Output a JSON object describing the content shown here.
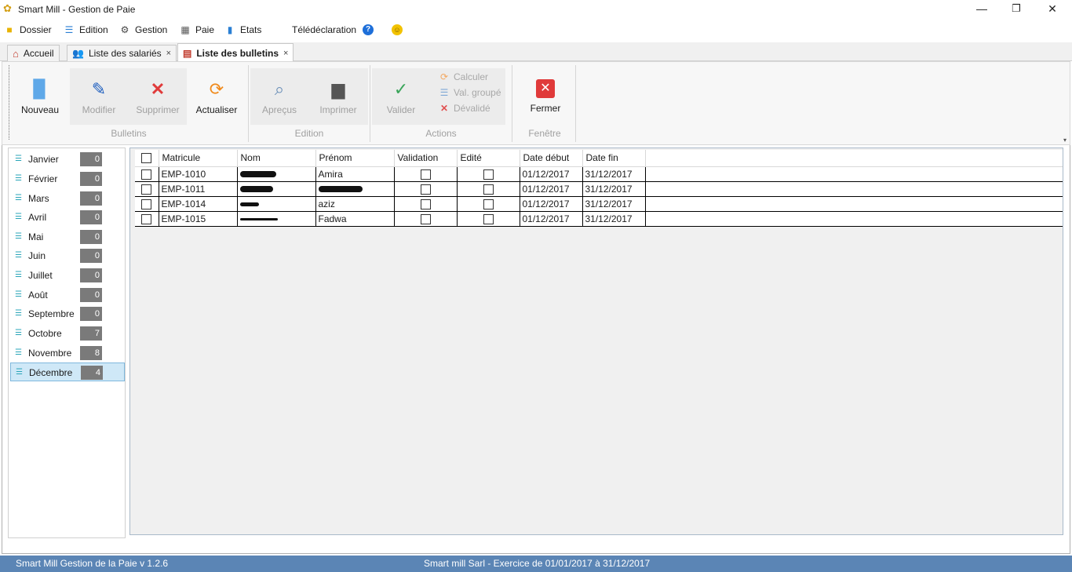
{
  "window": {
    "title": "Smart Mill - Gestion de Paie",
    "app_icon": "gear-flower-icon",
    "controls": [
      "minimize-icon",
      "restore-icon",
      "close-icon"
    ],
    "minimize_glyph": "—",
    "restore_glyph": "❐",
    "close_glyph": "✕"
  },
  "menu": {
    "items": [
      {
        "label": "Dossier",
        "icon": "folder-icon",
        "color": "#e8b300"
      },
      {
        "label": "Edition",
        "icon": "list-icon",
        "color": "#2a7fd4"
      },
      {
        "label": "Gestion",
        "icon": "gears-icon",
        "color": "#444444"
      },
      {
        "label": "Paie",
        "icon": "calculator-icon",
        "color": "#555555"
      },
      {
        "label": "Etats",
        "icon": "chart-icon",
        "color": "#2a7fd4"
      },
      {
        "label": "Télédéclaration",
        "icon": "help-icon",
        "color": "#1e6fd9"
      },
      {
        "label": "",
        "icon": "help-icon",
        "color": "#1e6fd9"
      },
      {
        "label": "",
        "icon": "smiley-icon",
        "color": "#f2c200"
      }
    ]
  },
  "tabs": [
    {
      "label": "Accueil",
      "icon": "home-icon",
      "closable": false,
      "active": false
    },
    {
      "label": "Liste des salariés",
      "icon": "users-icon",
      "closable": true,
      "active": false
    },
    {
      "label": "Liste des bulletins",
      "icon": "payslip-icon",
      "closable": true,
      "active": true
    }
  ],
  "tab_close_glyph": "×",
  "ribbon": {
    "groups": [
      {
        "label": "Bulletins"
      },
      {
        "label": "Edition"
      },
      {
        "label": "Actions"
      },
      {
        "label": "Fenêtre"
      }
    ],
    "buttons": {
      "nouveau": {
        "label": "Nouveau",
        "icon": "new-document-icon",
        "enabled": true
      },
      "modifier": {
        "label": "Modifier",
        "icon": "pencil-icon",
        "enabled": false
      },
      "supprimer": {
        "label": "Supprimer",
        "icon": "delete-x-icon",
        "enabled": false
      },
      "actualiser": {
        "label": "Actualiser",
        "icon": "refresh-icon",
        "enabled": true
      },
      "apercus": {
        "label": "Apreçus",
        "icon": "preview-icon",
        "enabled": false
      },
      "imprimer": {
        "label": "Imprimer",
        "icon": "printer-icon",
        "enabled": false
      },
      "valider": {
        "label": "Valider",
        "icon": "checkmark-icon",
        "enabled": false
      },
      "calculer": {
        "label": "Calculer",
        "icon": "refresh-icon",
        "enabled": false
      },
      "val_groupe": {
        "label": "Val. groupé",
        "icon": "list-icon",
        "enabled": false
      },
      "devalide": {
        "label": "Dévalidé",
        "icon": "delete-x-icon",
        "enabled": false
      },
      "fermer": {
        "label": "Fermer",
        "icon": "close-box-icon",
        "enabled": true
      }
    }
  },
  "months": [
    {
      "label": "Janvier",
      "count": "0"
    },
    {
      "label": "Février",
      "count": "0"
    },
    {
      "label": "Mars",
      "count": "0"
    },
    {
      "label": "Avril",
      "count": "0"
    },
    {
      "label": "Mai",
      "count": "0"
    },
    {
      "label": "Juin",
      "count": "0"
    },
    {
      "label": "Juillet",
      "count": "0"
    },
    {
      "label": "Août",
      "count": "0"
    },
    {
      "label": "Septembre",
      "count": "0"
    },
    {
      "label": "Octobre",
      "count": "7"
    },
    {
      "label": "Novembre",
      "count": "8"
    },
    {
      "label": "Décembre",
      "count": "4",
      "selected": true
    }
  ],
  "grid": {
    "columns": [
      "",
      "Matricule",
      "Nom",
      "Prénom",
      "Validation",
      "Edité",
      "Date début",
      "Date fin"
    ],
    "rows": [
      {
        "matricule": "EMP-1010",
        "nom_redacted": true,
        "prenom": "Amira",
        "prenom_redacted": false,
        "validation": false,
        "edite": false,
        "date_debut": "01/12/2017",
        "date_fin": "31/12/2017"
      },
      {
        "matricule": "EMP-1011",
        "nom_redacted": true,
        "prenom": "",
        "prenom_redacted": true,
        "validation": false,
        "edite": false,
        "date_debut": "01/12/2017",
        "date_fin": "31/12/2017"
      },
      {
        "matricule": "EMP-1014",
        "nom_redacted": true,
        "prenom": "aziz",
        "prenom_redacted": false,
        "validation": false,
        "edite": false,
        "date_debut": "01/12/2017",
        "date_fin": "31/12/2017"
      },
      {
        "matricule": "EMP-1015",
        "nom_redacted": true,
        "prenom": "Fadwa",
        "prenom_redacted": false,
        "validation": false,
        "edite": false,
        "date_debut": "01/12/2017",
        "date_fin": "31/12/2017"
      }
    ]
  },
  "status": {
    "left": "Smart Mill Gestion de la Paie v 1.2.6",
    "center": "Smart mill Sarl - Exercice de 01/01/2017 à 31/12/2017",
    "bar_color": "#5b85b5"
  }
}
